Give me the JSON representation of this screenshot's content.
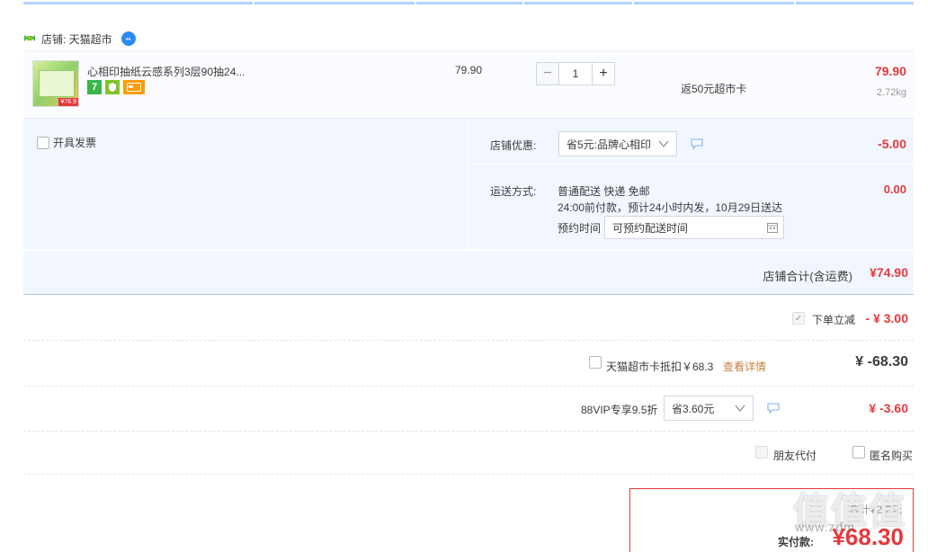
{
  "shop": {
    "name_label": "店铺: 天猫超市"
  },
  "item": {
    "title": "心相印抽纸云感系列3层90抽24...",
    "thumb_price_tag": "¥76.9",
    "badge_seven": "7",
    "unit_price": "79.90",
    "quantity": "1",
    "minus": "−",
    "plus": "+",
    "rebate": "返50元超市卡",
    "total": "79.90",
    "weight": "2.72kg"
  },
  "options": {
    "invoice_label": "开具发票",
    "discount_label": "店铺优惠:",
    "discount_select": "省5元:品牌心相印",
    "discount_amount": "-5.00",
    "shipping_label": "运送方式:",
    "shipping_line1": "普通配送 快递 免邮",
    "shipping_line2": "24:00前付款，预计24小时内发，10月29日送达",
    "appointment_label": "预约时间",
    "appointment_placeholder": "可预约配送时间",
    "shipping_amount": "0.00"
  },
  "shop_total": {
    "label": "店铺合计(含运费)",
    "value": "¥74.90"
  },
  "order_discount": {
    "label": "下单立减",
    "value": "- ¥ 3.00"
  },
  "supermarket_card": {
    "label": "天猫超市卡抵扣￥68.3",
    "link": "查看详情",
    "value": "¥ -68.30"
  },
  "vip": {
    "label": "88VIP专享9.5折",
    "select": "省3.60元",
    "value": "¥ -3.60"
  },
  "extra": {
    "friend_pay": "朋友代付",
    "anonymous": "匿名购买"
  },
  "pay": {
    "sum_line": "合计¥2.2元",
    "label": "实付款:",
    "value": "¥68.30"
  },
  "watermark": {
    "text": "值值值",
    "url": "www.zdm"
  },
  "colors": {
    "accent": "#e4393c",
    "panel": "#f2f7ff",
    "border_blue": "#b2d1ff",
    "link": "#c6813f"
  }
}
